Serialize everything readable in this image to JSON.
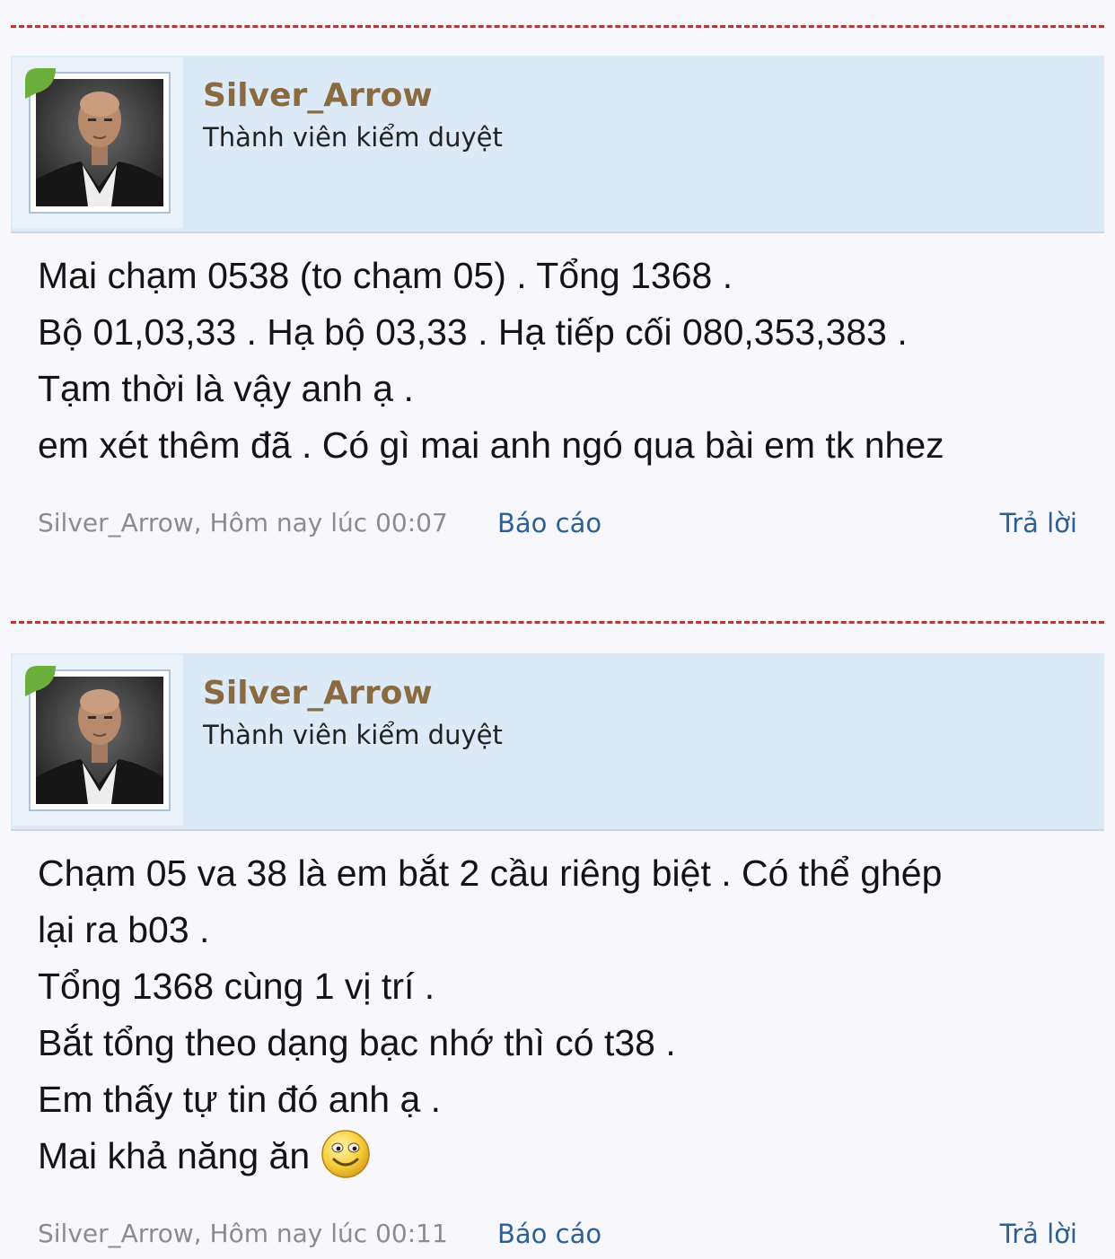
{
  "posts": [
    {
      "username": "Silver_Arrow",
      "user_title": "Thành viên kiểm duyệt",
      "lines": [
        "Mai chạm 0538 (to chạm 05) . Tổng 1368 .",
        "Bộ 01,03,33 . Hạ bộ 03,33 . Hạ tiếp cối 080,353,383 .",
        "Tạm thời là vậy anh ạ .",
        "em xét thêm đã . Có gì mai anh ngó qua bài em tk nhez"
      ],
      "meta": "Silver_Arrow, Hôm nay lúc 00:07",
      "report_label": "Báo cáo",
      "reply_label": "Trả lời"
    },
    {
      "username": "Silver_Arrow",
      "user_title": "Thành viên kiểm duyệt",
      "lines": [
        "Chạm 05 va 38 là em bắt 2 cầu riêng biệt . Có thể ghép",
        "lại ra b03 .",
        "Tổng 1368 cùng 1 vị trí .",
        "Bắt tổng theo dạng bạc nhớ thì có t38 .",
        "Em thấy tự tin đó anh ạ .",
        "Mai khả năng ăn"
      ],
      "emoticon": "smiley-emoticon",
      "meta": "Silver_Arrow, Hôm nay lúc 00:11",
      "report_label": "Báo cáo",
      "reply_label": "Trả lời"
    }
  ],
  "colors": {
    "divider": "#b33a3a",
    "userbar_bg": "#dce9f6",
    "username": "#8a6a40",
    "link": "#2c5f94",
    "meta": "#8c8c8c"
  }
}
